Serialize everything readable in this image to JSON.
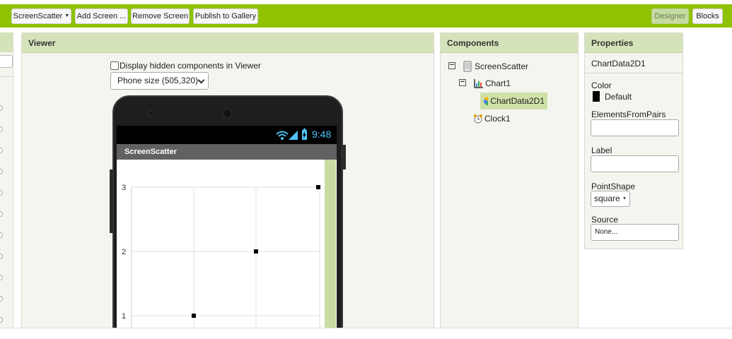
{
  "toolbar": {
    "screen_select": "ScreenScatter",
    "add_screen": "Add Screen ...",
    "remove_screen": "Remove Screen",
    "publish": "Publish to Gallery",
    "designer": "Designer",
    "blocks": "Blocks"
  },
  "viewer": {
    "title": "Viewer",
    "hidden_components_label": "Display hidden components in Viewer",
    "phone_size": "Phone size (505,320)",
    "status_time": "9:48",
    "app_title": "ScreenScatter"
  },
  "chart_data": {
    "type": "scatter",
    "x": [
      1,
      2,
      3
    ],
    "y": [
      1,
      2,
      3
    ],
    "yticks": [
      "3",
      "2",
      "1"
    ],
    "marker": "square",
    "grid": true
  },
  "components": {
    "title": "Components",
    "items": [
      {
        "label": "ScreenScatter",
        "icon": "screen-icon"
      },
      {
        "label": "Chart1",
        "icon": "chart-icon"
      },
      {
        "label": "ChartData2D1",
        "icon": "chart-data-icon"
      },
      {
        "label": "Clock1",
        "icon": "clock-icon"
      }
    ]
  },
  "properties": {
    "title": "Properties",
    "component_name": "ChartData2D1",
    "color_label": "Color",
    "color_value": "Default",
    "elements_label": "ElementsFromPairs",
    "label_label": "Label",
    "pointshape_label": "PointShape",
    "pointshape_value": "square",
    "source_label": "Source",
    "source_value": "None..."
  },
  "colors": {
    "toolbar": "#8fc202",
    "panel_header": "#d5e3ba",
    "selected": "#cfe1a8"
  }
}
